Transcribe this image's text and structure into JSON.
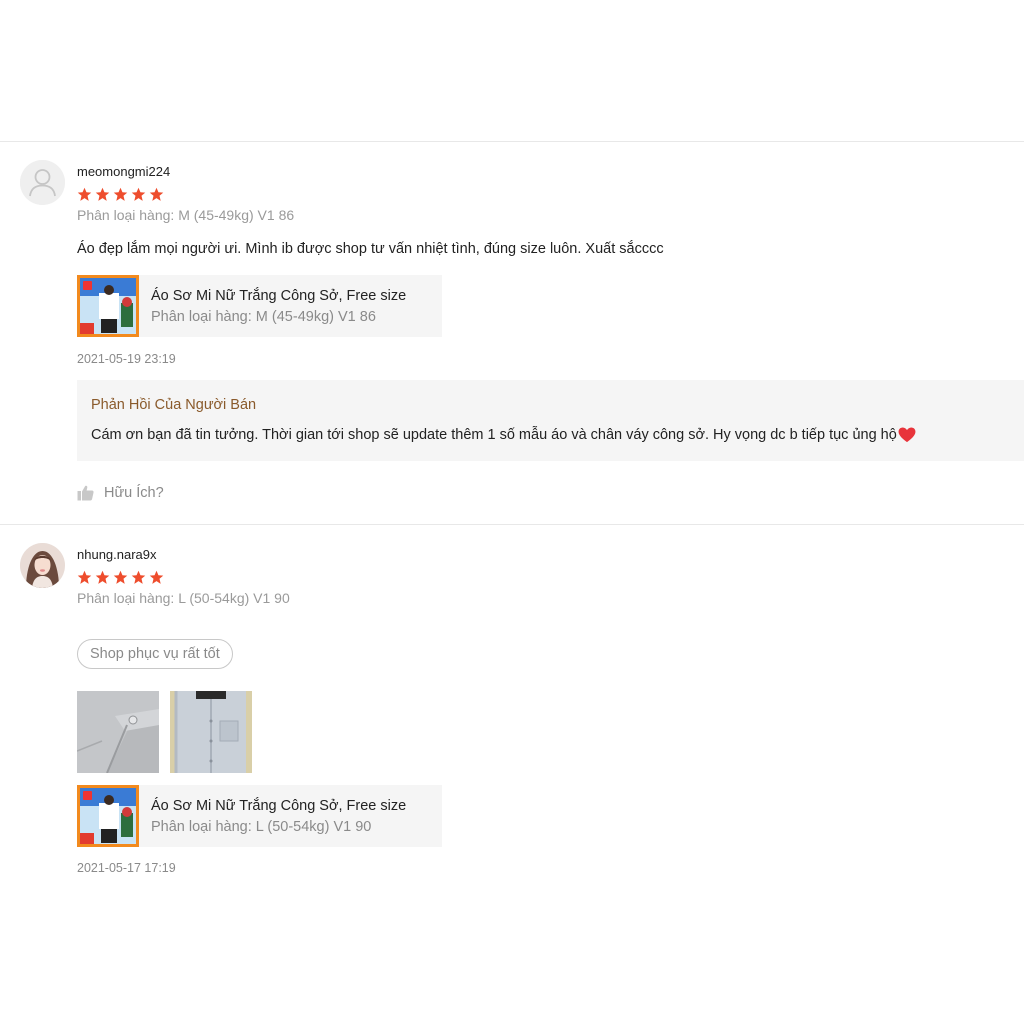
{
  "reviews": [
    {
      "username": "meomongmi224",
      "rating": 5,
      "variant": "Phân loại hàng: M (45-49kg) V1 86",
      "comment": "Áo đẹp lắm mọi người ưi. Mình ib được shop tư vấn nhiệt tình, đúng size luôn. Xuất sắcccc",
      "product": {
        "name": "Áo Sơ Mi Nữ Trắng Công Sở, Free size",
        "variant": "Phân loại hàng: M (45-49kg) V1 86"
      },
      "timestamp": "2021-05-19 23:19",
      "seller_reply": {
        "title": "Phản Hồi Của Người Bán",
        "text": "Cám ơn bạn đã tin tưởng. Thời gian tới shop sẽ update thêm 1 số mẫu áo và chân váy công sở. Hy vọng dc b tiếp tục ủng hộ"
      },
      "helpful_label": "Hữu Ích?"
    },
    {
      "username": "nhung.nara9x",
      "rating": 5,
      "variant": "Phân loại hàng: L (50-54kg) V1 90",
      "tag": "Shop phục vụ rất tốt",
      "product": {
        "name": "Áo Sơ Mi Nữ Trắng Công Sở, Free size",
        "variant": "Phân loại hàng: L (50-54kg) V1 90"
      },
      "timestamp": "2021-05-17 17:19"
    }
  ],
  "colors": {
    "star": "#ee4d2d",
    "reply_title": "#8a5a2b",
    "heart": "#e8343b"
  },
  "icons": {
    "default_avatar": "user-silhouette-icon",
    "star": "star-icon",
    "helpful": "thumbs-up-icon",
    "heart": "heart-icon"
  }
}
